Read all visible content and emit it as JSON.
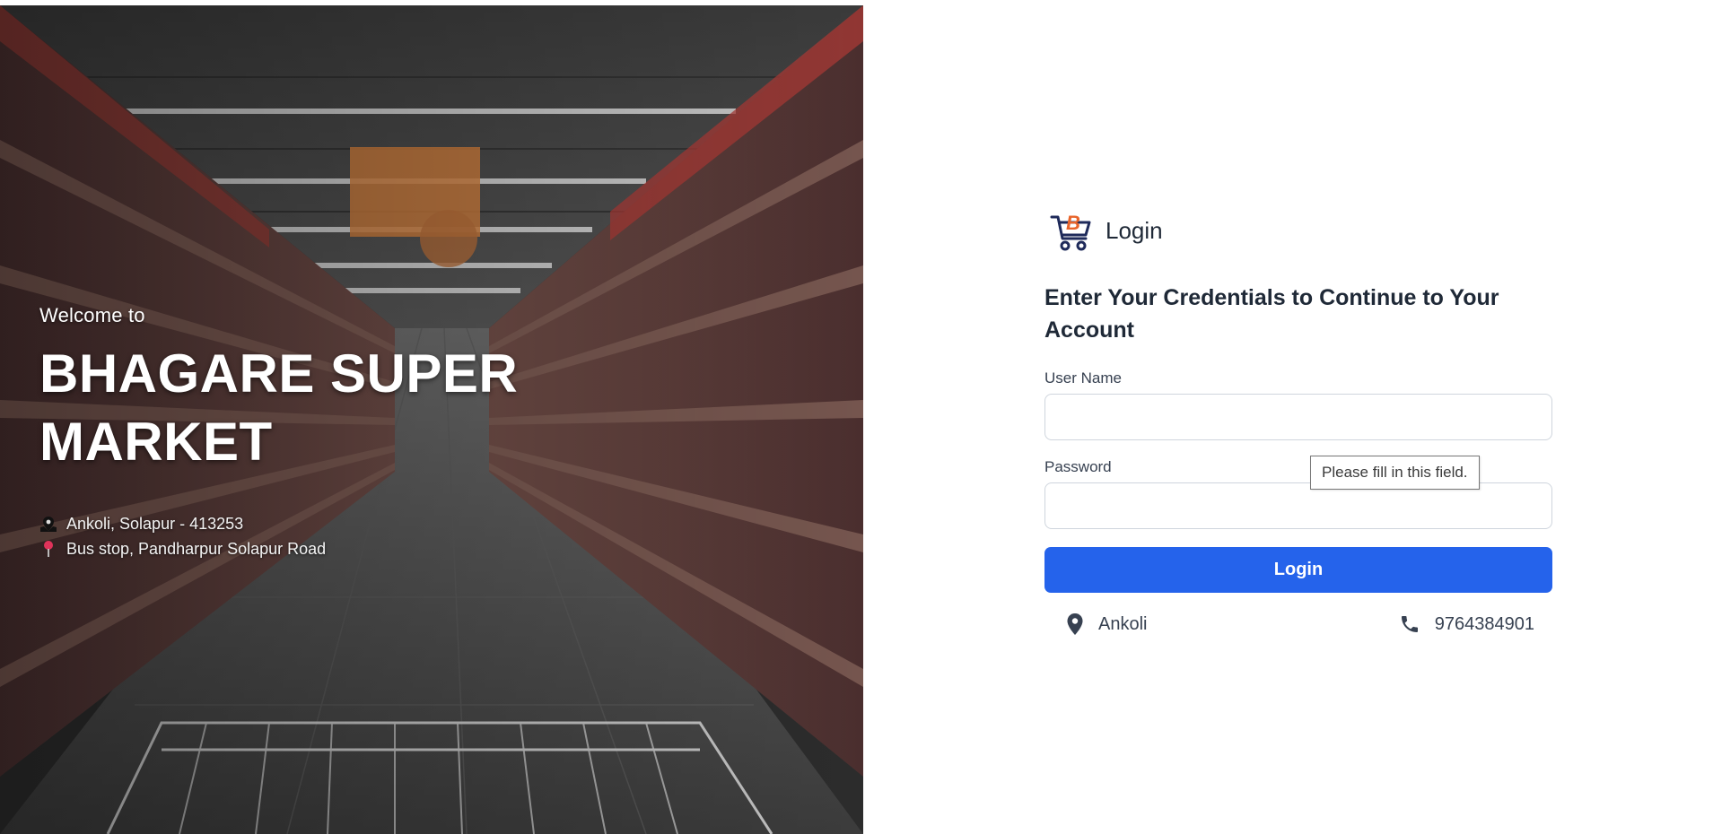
{
  "hero": {
    "welcome": "Welcome to",
    "brand_line1": "BHAGARE SUPER",
    "brand_line2": "MARKET",
    "address_line1": "Ankoli, Solapur - 413253",
    "address_line2": "Bus stop, Pandharpur Solapur Road",
    "icons": [
      "map-icon",
      "pushpin-icon"
    ]
  },
  "login": {
    "title": "Login",
    "subtitle": "Enter Your Credentials to Continue to Your Account",
    "username_label": "User Name",
    "username_value": "",
    "password_label": "Password",
    "password_value": "",
    "submit_label": "Login",
    "validation_tooltip": "Please fill in this field."
  },
  "footer": {
    "location": "Ankoli",
    "phone": "9764384901",
    "icons": [
      "location-pin-icon",
      "phone-icon"
    ]
  },
  "colors": {
    "primary": "#2563eb",
    "logo_orange": "#e8642b",
    "logo_navy": "#1e2a5a",
    "text_dark": "#1f2937"
  }
}
